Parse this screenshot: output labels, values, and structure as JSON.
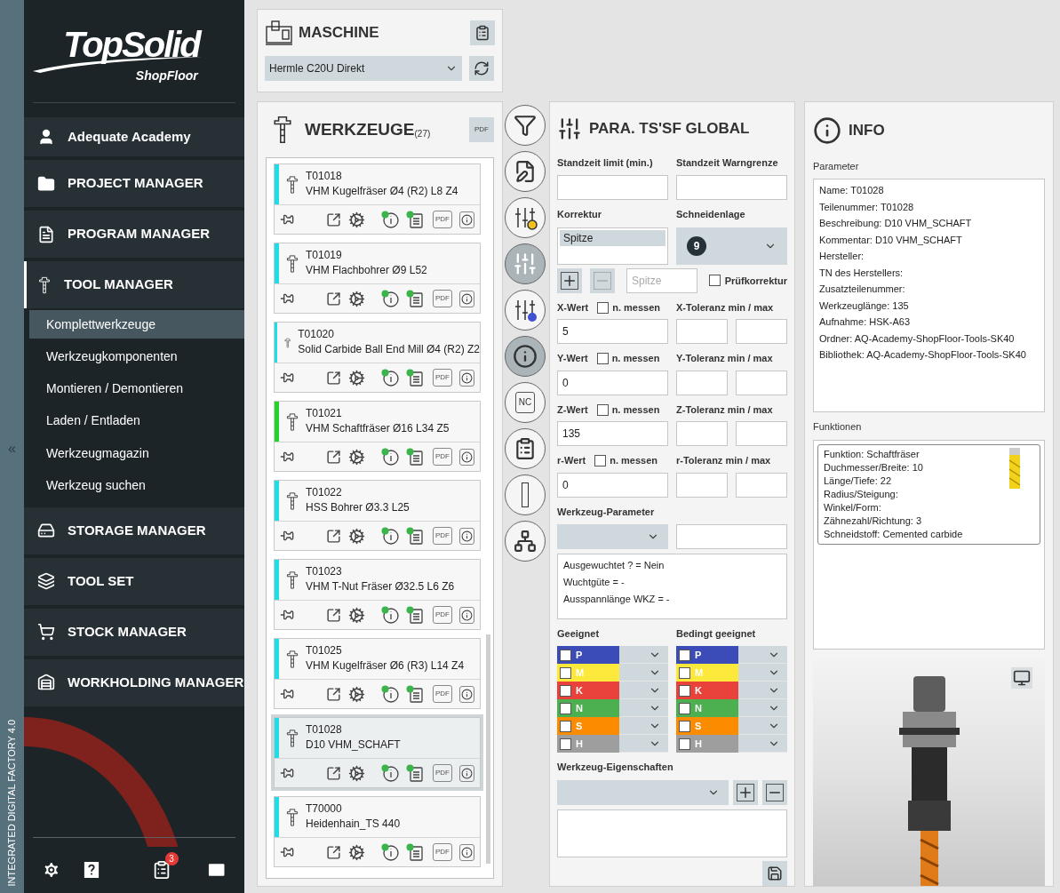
{
  "sidebar": {
    "collapse_symbol": "«",
    "vertical_caption": "INTEGRATED DIGITAL FACTORY 4.0",
    "logo": {
      "title": "TopSolid",
      "subtitle": "ShopFloor"
    },
    "nav": [
      {
        "label": "Adequate Academy",
        "kind": "user",
        "selected": false
      },
      {
        "label": "PROJECT MANAGER",
        "kind": "folder",
        "selected": false
      },
      {
        "label": "PROGRAM MANAGER",
        "kind": "program",
        "selected": false
      },
      {
        "label": "TOOL MANAGER",
        "kind": "tool",
        "selected": true,
        "children": [
          {
            "label": "Komplettwerkzeuge",
            "selected": true
          },
          {
            "label": "Werkzeugkomponenten",
            "selected": false
          },
          {
            "label": "Montieren / Demontieren",
            "selected": false
          },
          {
            "label": "Laden / Entladen",
            "selected": false
          },
          {
            "label": "Werkzeugmagazin",
            "selected": false
          },
          {
            "label": "Werkzeug suchen",
            "selected": false
          }
        ]
      },
      {
        "label": "STORAGE MANAGER",
        "kind": "storage",
        "selected": false
      },
      {
        "label": "TOOL SET",
        "kind": "toolset",
        "selected": false
      },
      {
        "label": "STOCK MANAGER",
        "kind": "stock",
        "selected": false
      },
      {
        "label": "WORKHOLDING MANAGER",
        "kind": "workholding",
        "selected": false
      }
    ],
    "footer": {
      "notification_count": "3"
    }
  },
  "machine": {
    "title": "MASCHINE",
    "value": "Hermle C20U Direkt"
  },
  "tools": {
    "title": "WERKZEUGE",
    "count": "(27)",
    "pdf_label": "PDF",
    "items": [
      {
        "id": "T01018",
        "name": "VHM Kugelfräser Ø4 (R2) L8 Z4",
        "color": "#1fdde6",
        "selected": false,
        "pdf_label": "PDF"
      },
      {
        "id": "T01019",
        "name": "VHM Flachbohrer Ø9 L52",
        "color": "#1fdde6",
        "selected": false,
        "pdf_label": "PDF"
      },
      {
        "id": "T01020",
        "name": "Solid Carbide Ball End Mill Ø4 (R2) Z2",
        "color": "#1fdde6",
        "selected": false,
        "pdf_label": "PDF"
      },
      {
        "id": "T01021",
        "name": "VHM Schaftfräser Ø16 L34 Z5",
        "color": "#22d42a",
        "selected": false,
        "pdf_label": "PDF"
      },
      {
        "id": "T01022",
        "name": "HSS Bohrer Ø3.3 L25",
        "color": "#1fdde6",
        "selected": false,
        "pdf_label": "PDF"
      },
      {
        "id": "T01023",
        "name": "VHM T-Nut Fräser Ø32.5 L6 Z6",
        "color": "#1fdde6",
        "selected": false,
        "pdf_label": "PDF"
      },
      {
        "id": "T01025",
        "name": "VHM Kugelfräser Ø6 (R3) L14 Z4",
        "color": "#1fdde6",
        "selected": false,
        "pdf_label": "PDF"
      },
      {
        "id": "T01028",
        "name": "D10 VHM_SCHAFT",
        "color": "#1fdde6",
        "selected": true,
        "pdf_label": "PDF"
      },
      {
        "id": "T70000",
        "name": "Heidenhain_TS 440",
        "color": "#1fdde6",
        "selected": false,
        "pdf_label": "PDF"
      }
    ]
  },
  "side_tools": [
    {
      "kind": "filter",
      "active": false
    },
    {
      "kind": "edit",
      "active": false
    },
    {
      "kind": "sliders-yellow",
      "active": false
    },
    {
      "kind": "sliders",
      "active": true
    },
    {
      "kind": "sliders-blue",
      "active": false
    },
    {
      "kind": "info",
      "active": true
    },
    {
      "kind": "nc",
      "label": "NC",
      "active": false
    },
    {
      "kind": "clipboard",
      "active": false
    },
    {
      "kind": "bar",
      "active": false
    },
    {
      "kind": "network",
      "active": false
    }
  ],
  "params": {
    "title": "PARA. TS'SF GLOBAL",
    "standzeit": [
      {
        "label": "Standzeit limit (min.)"
      },
      {
        "label": "Standzeit Warngrenze"
      }
    ],
    "korrektur": {
      "label": "Korrektur",
      "items": [
        {
          "label": "Spitze",
          "selected": true
        }
      ]
    },
    "schneidenlage": {
      "label": "Schneidenlage",
      "value": "9"
    },
    "korrektur_name": {
      "placeholder": "Spitze"
    },
    "pruefkorrektur": {
      "label": "Prüfkorrektur",
      "checked": false
    },
    "axes": [
      {
        "label": "X-Wert",
        "measure_label": "n. messen",
        "measure_checked": false,
        "value": "5",
        "tolerance_label": "X-Toleranz min / max"
      },
      {
        "label": "Y-Wert",
        "measure_label": "n. messen",
        "measure_checked": false,
        "value": "0",
        "tolerance_label": "Y-Toleranz min / max"
      },
      {
        "label": "Z-Wert",
        "measure_label": "n. messen",
        "measure_checked": false,
        "value": "135",
        "tolerance_label": "Z-Toleranz min / max"
      },
      {
        "label": "r-Wert",
        "measure_label": "n. messen",
        "measure_checked": false,
        "value": "0",
        "tolerance_label": "r-Toleranz min / max"
      }
    ],
    "werkzeug_parameter": {
      "label": "Werkzeug-Parameter",
      "lines": [
        "Ausgewuchtet ? = Nein",
        "Wuchtgüte = -",
        "Ausspannlänge WKZ = -"
      ]
    },
    "suitability": [
      {
        "label": "Geeignet",
        "materials": [
          {
            "letter": "P",
            "color": "#3b4cb8",
            "checked": false
          },
          {
            "letter": "M",
            "color": "#fde83c",
            "checked": false
          },
          {
            "letter": "K",
            "color": "#e8423a",
            "checked": false
          },
          {
            "letter": "N",
            "color": "#4caf50",
            "checked": false
          },
          {
            "letter": "S",
            "color": "#fb8c00",
            "checked": false
          },
          {
            "letter": "H",
            "color": "#9e9e9e",
            "checked": false
          }
        ]
      },
      {
        "label": "Bedingt geeignet",
        "materials": [
          {
            "letter": "P",
            "color": "#3b4cb8",
            "checked": false
          },
          {
            "letter": "M",
            "color": "#fde83c",
            "checked": false
          },
          {
            "letter": "K",
            "color": "#e8423a",
            "checked": false
          },
          {
            "letter": "N",
            "color": "#4caf50",
            "checked": false
          },
          {
            "letter": "S",
            "color": "#fb8c00",
            "checked": false
          },
          {
            "letter": "H",
            "color": "#9e9e9e",
            "checked": false
          }
        ]
      }
    ],
    "eigenschaften": {
      "label": "Werkzeug-Eigenschaften"
    }
  },
  "info": {
    "title": "INFO",
    "parameter_label": "Parameter",
    "parameters": [
      "Name: T01028",
      "Teilenummer: T01028",
      "Beschreibung: D10 VHM_SCHAFT",
      "Kommentar: D10 VHM_SCHAFT",
      "Hersteller:",
      "TN des Herstellers:",
      "Zusatzteilenummer:",
      "Werkzeuglänge: 135",
      "Aufnahme: HSK-A63",
      "Ordner: AQ-Academy-ShopFloor-Tools-SK40",
      "Bibliothek: AQ-Academy-ShopFloor-Tools-SK40"
    ],
    "functions_label": "Funktionen",
    "functions": [
      "Funktion: Schaftfräser",
      "Duchmesser/Breite: 10",
      "Länge/Tiefe: 22",
      "Radius/Steigung:",
      "Winkel/Form:",
      "Zähnezahl/Richtung: 3",
      "Schneidstoff: Cemented carbide"
    ]
  }
}
